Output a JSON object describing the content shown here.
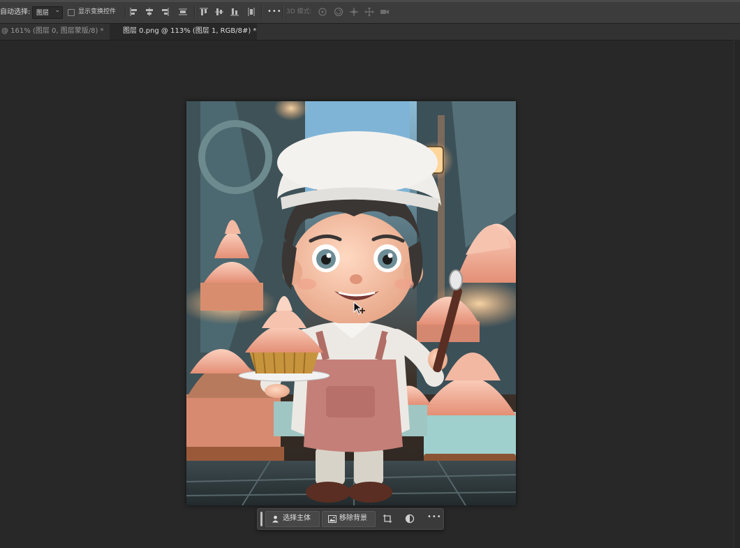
{
  "options_bar": {
    "auto_select_label": "自动选择:",
    "auto_select_value": "图层",
    "show_transform_label": "显示变换控件",
    "more_label": "•••",
    "mode_3d_label": "3D 模式:"
  },
  "tabs": [
    {
      "label": "@ 161% (图层 0, 图层蒙版/8) *",
      "active": false
    },
    {
      "label": "图层 0.png @ 113% (图层 1, RGB/8#) *",
      "active": true
    }
  ],
  "contextual_taskbar": {
    "select_subject": "选择主体",
    "remove_background": "移除背景",
    "more": "•••"
  },
  "colors": {
    "app_bg": "#282828",
    "panel_bg": "#3c3c3c",
    "accent_pink": "#e69a86"
  },
  "icons": [
    "align-left-icon",
    "align-hcenter-icon",
    "align-right-icon",
    "distribute-h-icon",
    "align-top-icon",
    "align-vcenter-icon",
    "align-bottom-icon",
    "distribute-v-icon",
    "orbit-icon",
    "roll-icon",
    "pan-icon",
    "slide-icon",
    "camera-icon",
    "person-icon",
    "image-icon",
    "crop-icon",
    "adjustment-icon"
  ]
}
